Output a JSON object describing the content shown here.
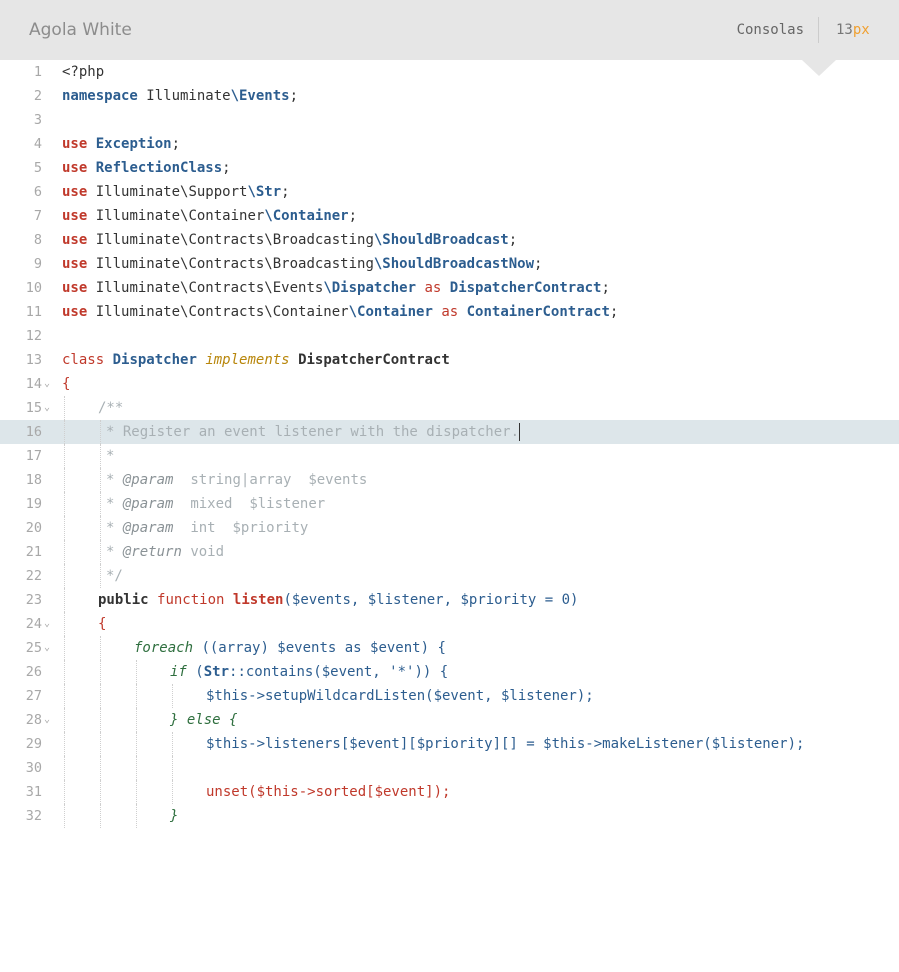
{
  "header": {
    "theme_title": "Agola White",
    "font_name": "Consolas",
    "font_size_value": "13",
    "font_size_unit": "px"
  },
  "editor": {
    "line_numbers": [
      "1",
      "2",
      "3",
      "4",
      "5",
      "6",
      "7",
      "8",
      "9",
      "10",
      "11",
      "12",
      "13",
      "14",
      "15",
      "16",
      "17",
      "18",
      "19",
      "20",
      "21",
      "22",
      "23",
      "24",
      "25",
      "26",
      "27",
      "28",
      "29",
      "30",
      "31",
      "32"
    ],
    "fold_marker": "⌄",
    "active_line": "16"
  },
  "code": {
    "l1": "<?php",
    "l2_kw": "namespace",
    "l2_ns": " Illuminate",
    "l2_cls": "\\Events",
    "l2_end": ";",
    "use_kw": "use",
    "l4_cls": "Exception",
    "l5_cls": "ReflectionClass",
    "l6_ns": " Illuminate\\Support",
    "l6_cls": "\\Str",
    "l7_ns": " Illuminate\\Container",
    "l7_cls": "\\Container",
    "l8_ns": " Illuminate\\Contracts\\Broadcasting",
    "l8_cls": "\\ShouldBroadcast",
    "l9_ns": " Illuminate\\Contracts\\Broadcasting",
    "l9_cls": "\\ShouldBroadcastNow",
    "l10_ns": " Illuminate\\Contracts\\Events",
    "l10_cls": "\\Dispatcher",
    "as_kw": "as",
    "l10_alias": "DispatcherContract",
    "l11_ns": " Illuminate\\Contracts\\Container",
    "l11_cls": "\\Container",
    "l11_alias": "ContainerContract",
    "semi": ";",
    "l13_kw": "class",
    "l13_cls": "Dispatcher",
    "l13_impl": "implements",
    "l13_iface": "DispatcherContract",
    "brace_open": "{",
    "brace_close": "}",
    "l15": "/**",
    "l16": "* Register an event listener with the dispatcher.",
    "l17": "*",
    "star": "*",
    "param_tag": "@param",
    "return_tag": "@return",
    "l18_type": "string|array",
    "l18_var": "$events",
    "l19_type": "mixed",
    "l19_var": "$listener",
    "l20_type": "int",
    "l20_var": "$priority",
    "l21_type": "void",
    "l22": "*/",
    "l23_pub": "public",
    "l23_fnkw": "function",
    "l23_name": "listen",
    "l23_args": "($events, $listener, $priority = 0)",
    "l25_foreach": "foreach",
    "l25_rest": " ((array) $events as $event) {",
    "l26_if": "if",
    "l26_open": " (",
    "l26_str": "Str",
    "l26_rest": "::contains($event, '*')) {",
    "l27": "$this->setupWildcardListen($event, $listener);",
    "l28_else": "} else {",
    "l29": "$this->listeners[$event][$priority][] = $this->makeListener($listener);",
    "l31": "unset($this->sorted[$event]);",
    "l32": "}"
  }
}
